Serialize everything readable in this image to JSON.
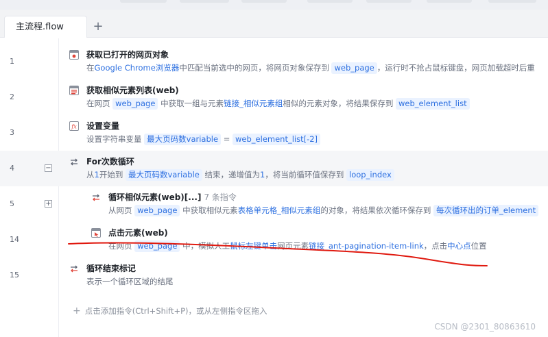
{
  "tabs": [
    {
      "label": "主流程.flow"
    }
  ],
  "tab_add_icon": "plus-icon",
  "rows": [
    {
      "line": "1",
      "title": "获取已打开的网页对象",
      "icon": "web-page-icon"
    },
    {
      "line": "2",
      "title": "获取相似元素列表(web)",
      "icon": "element-list-icon"
    },
    {
      "line": "3",
      "title": "设置变量",
      "icon": "variable-icon"
    },
    {
      "line": "4",
      "title": "For次数循环",
      "icon": "loop-icon",
      "fold": "−"
    },
    {
      "line": "5",
      "title": "循环相似元素(web)[...]",
      "count": "7 条指令",
      "icon": "loop-icon",
      "fold": "+"
    },
    {
      "line": "14",
      "title": "点击元素(web)",
      "icon": "click-icon"
    },
    {
      "line": "15",
      "title": "循环结束标记",
      "icon": "loop-end-icon"
    }
  ],
  "desc": {
    "r1": {
      "a": "在",
      "b": "Google Chrome浏览器",
      "c": "中匹配当前选中的网页，将网页对象保存到",
      "v1": "web_page",
      "d": "，运行时不抢占鼠标键盘，网页加载超时后重"
    },
    "r2": {
      "a": "在网页",
      "v1": "web_page",
      "b": "中获取一组与元素",
      "c": "链接_相似元素组",
      "d": "相似的元素对象，将结果保存到",
      "v2": "web_element_list"
    },
    "r3": {
      "a": "设置字符串变量",
      "v1": "最大页码数variable",
      "b": "=",
      "v2": "web_element_list[-2]"
    },
    "r4": {
      "a": "从",
      "b": "1",
      "c": "开始到",
      "v1": "最大页码数variable",
      "d": "结束，递增值为",
      "e": "1",
      "f": "，将当前循环值保存到",
      "v2": "loop_index"
    },
    "r5": {
      "a": "从网页",
      "v1": "web_page",
      "b": "中获取相似元素",
      "c": "表格单元格_相似元素组",
      "d": "的对象，将结果依次循环保存到",
      "v2": "每次循环出的订单_element"
    },
    "r14": {
      "a": "在网页",
      "v1": "web_page",
      "b": "中，模拟人工",
      "c": "鼠标左键单击",
      "d": "网页元素",
      "e": "链接_ant-pagination-item-link",
      "f": "，点击",
      "g": "中心点",
      "h": "位置"
    },
    "r15": {
      "a": "表示一个循环区域的结尾"
    }
  },
  "add_hint": "点击添加指令(Ctrl+Shift+P)，或从左侧指令区拖入",
  "watermark": "CSDN @2301_80863610",
  "colors": {
    "accent": "#2c6fe0",
    "var_bg": "#eaf2ff",
    "annotation": "#e0190f",
    "hover_row": "#f5f6f8"
  }
}
